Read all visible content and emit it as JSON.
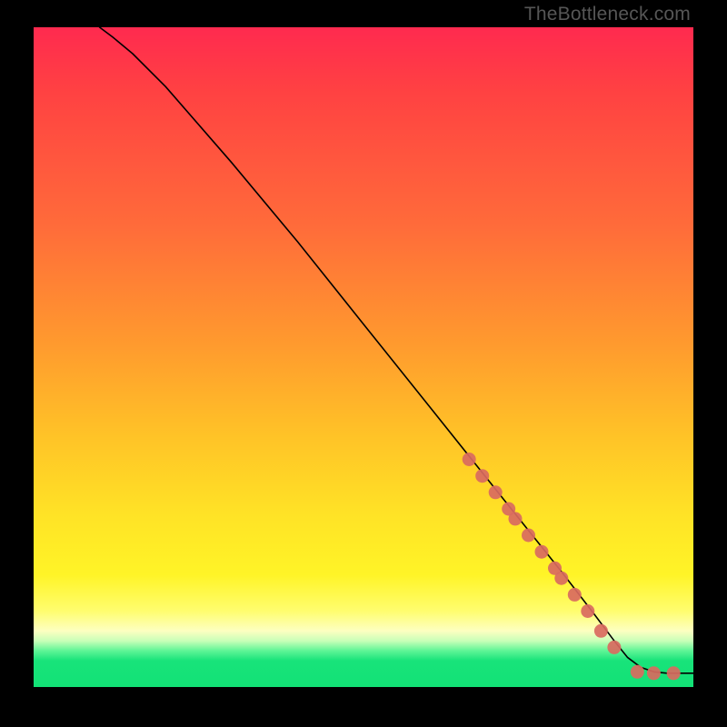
{
  "watermark": "TheBottleneck.com",
  "chart_data": {
    "type": "line",
    "title": "",
    "xlabel": "",
    "ylabel": "",
    "xlim": [
      0,
      100
    ],
    "ylim": [
      0,
      100
    ],
    "grid": false,
    "legend": false,
    "note": "Axis values are estimated percentages; chart has no visible tick labels.",
    "series": [
      {
        "name": "curve",
        "style": "solid-black",
        "x": [
          10,
          12,
          15,
          20,
          30,
          40,
          50,
          60,
          70,
          80,
          85,
          88,
          90,
          92,
          94,
          96,
          100
        ],
        "y": [
          100,
          98.5,
          96,
          91,
          79.5,
          67.5,
          55,
          42.5,
          30,
          17.5,
          11,
          7,
          4.5,
          3,
          2.3,
          2.1,
          2.1
        ]
      },
      {
        "name": "highlight-dots",
        "style": "salmon-dots",
        "x": [
          66,
          68,
          70,
          72,
          73,
          75,
          77,
          79,
          80,
          82,
          84,
          86,
          88,
          91.5,
          94,
          97
        ],
        "y": [
          34.5,
          32,
          29.5,
          27,
          25.5,
          23,
          20.5,
          18,
          16.5,
          14,
          11.5,
          8.5,
          6,
          2.3,
          2.1,
          2.1
        ]
      }
    ],
    "colors": {
      "curve": "#000000",
      "dots": "#d96a60",
      "gradient_top": "#ff2a4f",
      "gradient_mid": "#ffe326",
      "gradient_bottom": "#12e276"
    }
  }
}
